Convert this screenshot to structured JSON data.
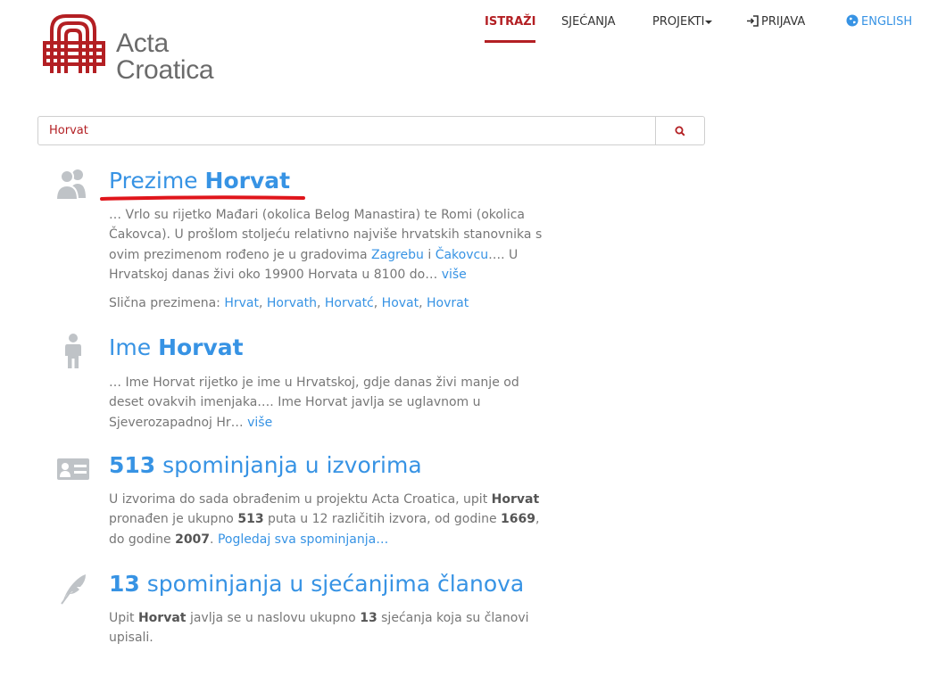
{
  "brand": {
    "line1": "Acta",
    "line2": "Croatica"
  },
  "nav": {
    "istrazi": "ISTRAŽI",
    "sjecanja": "SJEĆANJA",
    "projekti": "PROJEKTI",
    "prijava": "PRIJAVA",
    "english": "ENGLISH"
  },
  "search": {
    "value": "Horvat"
  },
  "results": {
    "surname": {
      "title_prefix": "Prezime",
      "title_term": "Horvat",
      "text_part1": "… Vrlo su rijetko Mađari (okolica Belog Manastira) te Romi (okolica Čakovca). U prošlom stoljeću relativno najviše hrvatskih stanovnika s ovim prezimenom rođeno je u gradovima",
      "link_zagreb": "Zagrebu",
      "and": "i",
      "link_cakovec": "Čakovcu",
      "text_part2": "…. U Hrvatskoj danas živi oko 19900 Horvata u 8100 do…",
      "more": "više",
      "similar_label": "Slična prezimena:",
      "similar": [
        "Hrvat",
        "Horvath",
        "Horvatć",
        "Hovat",
        "Hovrat"
      ]
    },
    "name": {
      "title_prefix": "Ime",
      "title_term": "Horvat",
      "text": "… Ime Horvat rijetko je ime u Hrvatskoj, gdje danas živi manje od deset ovakvih imenjaka…. Ime Horvat javlja se uglavnom u Sjeverozapadnoj Hr…",
      "more": "više"
    },
    "sources": {
      "count": "513",
      "title_rest": "spominjanja u izvorima",
      "t1": "U izvorima do sada obrađenim u projektu Acta Croatica, upit",
      "term": "Horvat",
      "t2": "pronađen je ukupno",
      "count_inline": "513",
      "t3": "puta u 12 različitih izvora, od godine",
      "year_from": "1669",
      "t4": ", do godine",
      "year_to": "2007",
      "t5": ".",
      "link": "Pogledaj sva spominjanja…"
    },
    "memories": {
      "count": "13",
      "title_rest": "spominjanja u sjećanjima članova",
      "t1": "Upit",
      "term": "Horvat",
      "t2": "javlja se u naslovu ukupno",
      "count_inline": "13",
      "t3": "sjećanja koja su članovi upisali."
    }
  },
  "colors": {
    "brand_red": "#b31f23",
    "link_blue": "#3793e4",
    "text_gray": "#777777",
    "icon_gray": "#bfc3c7"
  }
}
